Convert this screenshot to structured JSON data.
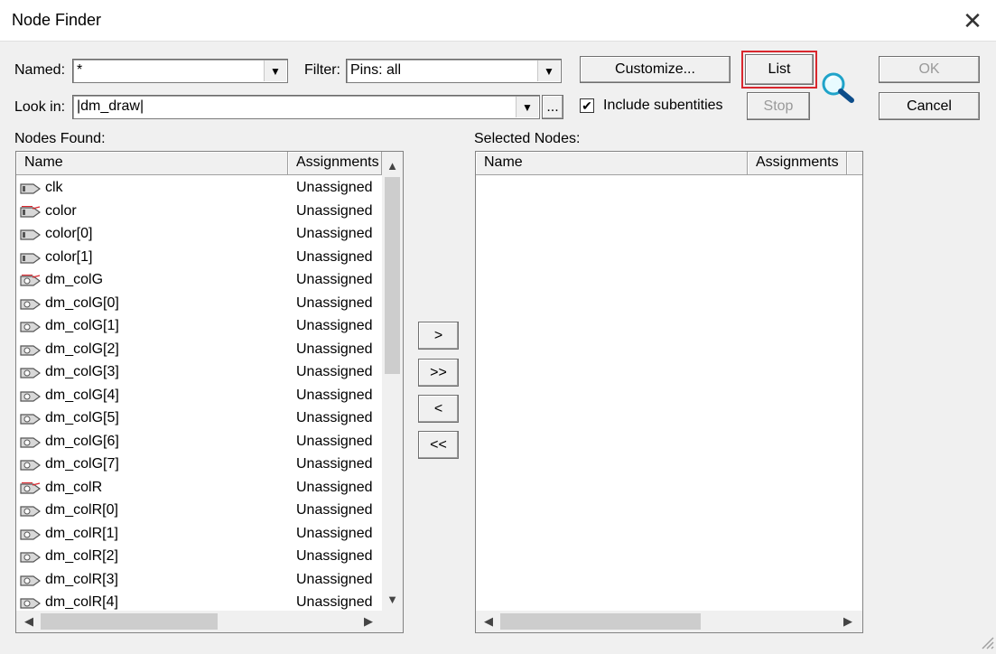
{
  "window": {
    "title": "Node Finder"
  },
  "named": {
    "label": "Named:",
    "value": "*"
  },
  "filter": {
    "label": "Filter:",
    "value": "Pins: all"
  },
  "look_in": {
    "label": "Look in:",
    "value": "|dm_draw|",
    "browse_label": "..."
  },
  "buttons": {
    "customize": "Customize...",
    "list": "List",
    "ok": "OK",
    "cancel": "Cancel",
    "stop": "Stop",
    "add": ">",
    "add_all": ">>",
    "remove": "<",
    "remove_all": "<<"
  },
  "include_subentities": {
    "label": "Include subentities",
    "checked": true
  },
  "nodes_found": {
    "label": "Nodes Found:",
    "columns": [
      "Name",
      "Assignments"
    ],
    "rows": [
      {
        "name": "clk",
        "assignment": "Unassigned",
        "icon": "input-pin-icon"
      },
      {
        "name": "color",
        "assignment": "Unassigned",
        "icon": "input-bus-pin-icon"
      },
      {
        "name": "color[0]",
        "assignment": "Unassigned",
        "icon": "input-pin-icon"
      },
      {
        "name": "color[1]",
        "assignment": "Unassigned",
        "icon": "input-pin-icon"
      },
      {
        "name": "dm_colG",
        "assignment": "Unassigned",
        "icon": "output-bus-pin-icon"
      },
      {
        "name": "dm_colG[0]",
        "assignment": "Unassigned",
        "icon": "output-pin-icon"
      },
      {
        "name": "dm_colG[1]",
        "assignment": "Unassigned",
        "icon": "output-pin-icon"
      },
      {
        "name": "dm_colG[2]",
        "assignment": "Unassigned",
        "icon": "output-pin-icon"
      },
      {
        "name": "dm_colG[3]",
        "assignment": "Unassigned",
        "icon": "output-pin-icon"
      },
      {
        "name": "dm_colG[4]",
        "assignment": "Unassigned",
        "icon": "output-pin-icon"
      },
      {
        "name": "dm_colG[5]",
        "assignment": "Unassigned",
        "icon": "output-pin-icon"
      },
      {
        "name": "dm_colG[6]",
        "assignment": "Unassigned",
        "icon": "output-pin-icon"
      },
      {
        "name": "dm_colG[7]",
        "assignment": "Unassigned",
        "icon": "output-pin-icon"
      },
      {
        "name": "dm_colR",
        "assignment": "Unassigned",
        "icon": "output-bus-pin-icon"
      },
      {
        "name": "dm_colR[0]",
        "assignment": "Unassigned",
        "icon": "output-pin-icon"
      },
      {
        "name": "dm_colR[1]",
        "assignment": "Unassigned",
        "icon": "output-pin-icon"
      },
      {
        "name": "dm_colR[2]",
        "assignment": "Unassigned",
        "icon": "output-pin-icon"
      },
      {
        "name": "dm_colR[3]",
        "assignment": "Unassigned",
        "icon": "output-pin-icon"
      },
      {
        "name": "dm_colR[4]",
        "assignment": "Unassigned",
        "icon": "output-pin-icon"
      }
    ]
  },
  "selected_nodes": {
    "label": "Selected Nodes:",
    "columns": [
      "Name",
      "Assignments"
    ]
  },
  "colors": {
    "highlight": "#d9272e",
    "search_icon": "#1fa3c9"
  }
}
